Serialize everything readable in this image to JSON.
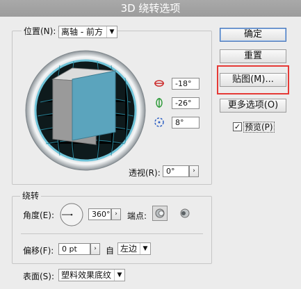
{
  "dialog": {
    "title": "3D 绕转选项"
  },
  "position": {
    "label": "位置(N):",
    "dropdown_value": "离轴 - 前方",
    "x_rotation": "-18°",
    "y_rotation": "-26°",
    "z_rotation": "8°",
    "perspective_label": "透视(R):",
    "perspective_value": "0°"
  },
  "revolve": {
    "group_label": "绕转",
    "angle_label": "角度(E):",
    "angle_value": "360°",
    "cap_label": "端点:",
    "offset_label": "偏移(F):",
    "offset_value": "0 pt",
    "from_label": "自",
    "from_value": "左边"
  },
  "surface": {
    "label": "表面(S):",
    "value": "塑料效果底纹"
  },
  "buttons": {
    "ok": "确定",
    "reset": "重置",
    "map": "贴图(M)...",
    "more": "更多选项(O)"
  },
  "preview": {
    "label": "预览(P)",
    "checked": true
  },
  "icons": {
    "x_axis": "x-rotate-icon",
    "y_axis": "y-rotate-icon",
    "z_axis": "z-rotate-icon",
    "angle_dial": "angle-dial-icon",
    "cap_on": "cap-on-icon",
    "cap_off": "cap-off-icon"
  },
  "colors": {
    "highlight_box": "#e53935",
    "cube_face": "#5ba4bd",
    "track_ring": "#6fc3d8"
  }
}
